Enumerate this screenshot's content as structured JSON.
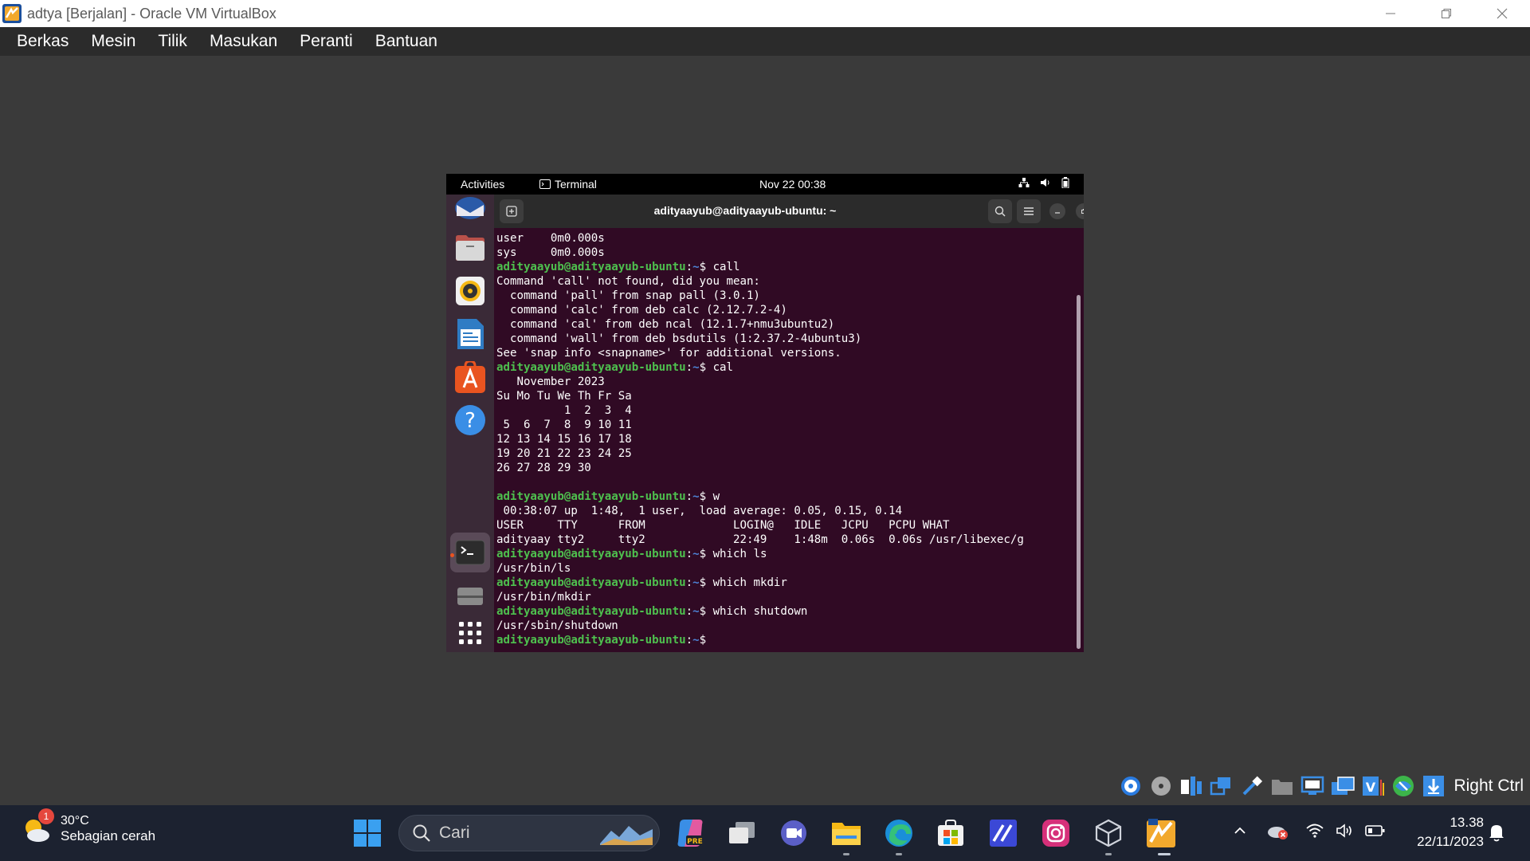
{
  "window": {
    "title": "adtya [Berjalan] - Oracle VM VirtualBox"
  },
  "menubar": {
    "items": [
      "Berkas",
      "Mesin",
      "Tilik",
      "Masukan",
      "Peranti",
      "Bantuan"
    ]
  },
  "guest": {
    "topbar": {
      "activities": "Activities",
      "app": "Terminal",
      "clock": "Nov 22  00:38"
    },
    "dock": {
      "items": [
        "thunderbird-icon",
        "files-icon",
        "rhythmbox-icon",
        "writer-icon",
        "app-center-icon",
        "help-icon",
        "terminal-icon",
        "optical-drive-icon",
        "show-apps-icon"
      ]
    },
    "terminal": {
      "title": "adityaayub@adityaayub-ubuntu: ~",
      "prompt_user": "adityaayub@adityaayub-ubuntu",
      "prompt_path": "~",
      "lines": [
        {
          "text": "user    0m0.000s"
        },
        {
          "text": "sys     0m0.000s"
        },
        {
          "prompt": true,
          "cmd": "call"
        },
        {
          "text": "Command 'call' not found, did you mean:"
        },
        {
          "text": "  command 'pall' from snap pall (3.0.1)"
        },
        {
          "text": "  command 'calc' from deb calc (2.12.7.2-4)"
        },
        {
          "text": "  command 'cal' from deb ncal (12.1.7+nmu3ubuntu2)"
        },
        {
          "text": "  command 'wall' from deb bsdutils (1:2.37.2-4ubuntu3)"
        },
        {
          "text": "See 'snap info <snapname>' for additional versions."
        },
        {
          "prompt": true,
          "cmd": "cal"
        },
        {
          "text": "   November 2023"
        },
        {
          "text": "Su Mo Tu We Th Fr Sa"
        },
        {
          "text": "          1  2  3  4"
        },
        {
          "text": " 5  6  7  8  9 10 11"
        },
        {
          "text": "12 13 14 15 16 17 18"
        },
        {
          "text": "19 20 21 22 23 24 25"
        },
        {
          "text": "26 27 28 29 30"
        },
        {
          "text": ""
        },
        {
          "prompt": true,
          "cmd": "w"
        },
        {
          "text": " 00:38:07 up  1:48,  1 user,  load average: 0.05, 0.15, 0.14"
        },
        {
          "text": "USER     TTY      FROM             LOGIN@   IDLE   JCPU   PCPU WHAT"
        },
        {
          "text": "adityaay tty2     tty2             22:49    1:48m  0.06s  0.06s /usr/libexec/g"
        },
        {
          "prompt": true,
          "cmd": "which ls"
        },
        {
          "text": "/usr/bin/ls"
        },
        {
          "prompt": true,
          "cmd": "which mkdir"
        },
        {
          "text": "/usr/bin/mkdir"
        },
        {
          "prompt": true,
          "cmd": "which shutdown"
        },
        {
          "text": "/usr/sbin/shutdown"
        },
        {
          "prompt": true,
          "cmd": ""
        }
      ]
    }
  },
  "vbox_status": {
    "host_key": "Right Ctrl",
    "icons": [
      "hard-disk-icon",
      "optical-disk-icon",
      "audio-icon",
      "network-icon",
      "usb-icon",
      "shared-folders-icon",
      "display-icon",
      "recording-icon",
      "vt-x-icon",
      "cpu-icon",
      "mouse-integration-icon"
    ]
  },
  "taskbar": {
    "weather": {
      "temp": "30°C",
      "desc": "Sebagian cerah",
      "badge": "1"
    },
    "search_placeholder": "Cari",
    "clock": {
      "time": "13.38",
      "date": "22/11/2023"
    }
  },
  "colors": {
    "terminal_bg": "#300a24",
    "prompt_user": "#4ec04e",
    "prompt_path": "#4d83d6",
    "ubuntu_orange": "#e95420",
    "taskbar_bg": "#1c2230"
  }
}
